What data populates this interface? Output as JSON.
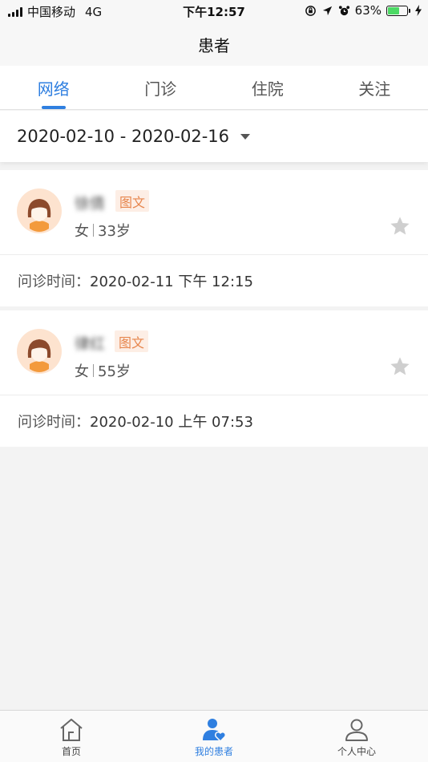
{
  "status_bar": {
    "carrier": "中国移动",
    "network": "4G",
    "time": "下午12:57",
    "battery": "63%",
    "battery_level": 0.63
  },
  "nav": {
    "title": "患者"
  },
  "tabs": [
    {
      "label": "网络",
      "active": true
    },
    {
      "label": "门诊",
      "active": false
    },
    {
      "label": "住院",
      "active": false
    },
    {
      "label": "关注",
      "active": false
    }
  ],
  "filter": {
    "date_range": "2020-02-10 - 2020-02-16"
  },
  "patients": [
    {
      "name": "徐倩",
      "tag": "图文",
      "gender": "女",
      "age": "33岁",
      "visit_label": "问诊时间：",
      "visit_time": "2020-02-11 下午 12:15"
    },
    {
      "name": "律红",
      "tag": "图文",
      "gender": "女",
      "age": "55岁",
      "visit_label": "问诊时间：",
      "visit_time": "2020-02-10 上午 07:53"
    }
  ],
  "tab_bar": [
    {
      "label": "首页",
      "icon": "home-icon",
      "active": false
    },
    {
      "label": "我的患者",
      "icon": "patients-icon",
      "active": true
    },
    {
      "label": "个人中心",
      "icon": "profile-icon",
      "active": false
    }
  ],
  "colors": {
    "accent": "#2f7fe0",
    "tag_text": "#e7864d",
    "tag_bg": "#fdeee5",
    "battery": "#4cd964"
  }
}
